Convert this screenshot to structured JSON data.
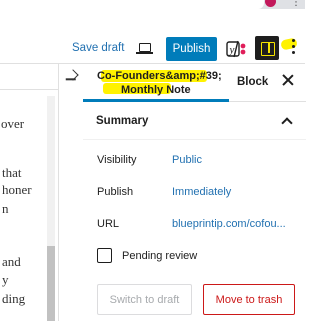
{
  "toolbar": {
    "save_draft_label": "Save draft",
    "publish_label": "Publish",
    "yoast_letter": "y"
  },
  "editor": {
    "lines": [
      "over",
      "that",
      "honer",
      "n",
      "and",
      "y",
      "ding"
    ]
  },
  "sidebar": {
    "tabs": {
      "post_tab_line1": "Co-Founders&amp;#39;",
      "post_tab_line2": "Monthly Note",
      "block_tab": "Block"
    },
    "summary": {
      "title": "Summary",
      "visibility_label": "Visibility",
      "visibility_value": "Public",
      "publish_label": "Publish",
      "publish_value": "Immediately",
      "url_label": "URL",
      "url_value": "blueprintip.com/cofou...",
      "pending_review_label": "Pending review",
      "pending_review_checked": false
    },
    "buttons": {
      "switch_to_draft": "Switch to draft",
      "move_to_trash": "Move to trash"
    }
  },
  "colors": {
    "accent": "#007cba",
    "link": "#2271b1",
    "danger": "#cc1818",
    "highlight": "#fff200"
  },
  "icons": {
    "preview": "desktop-preview-icon",
    "settings": "sidebar-settings-icon",
    "options": "more-vertical-icon",
    "close": "close-icon",
    "collapse": "chevron-up-icon"
  }
}
